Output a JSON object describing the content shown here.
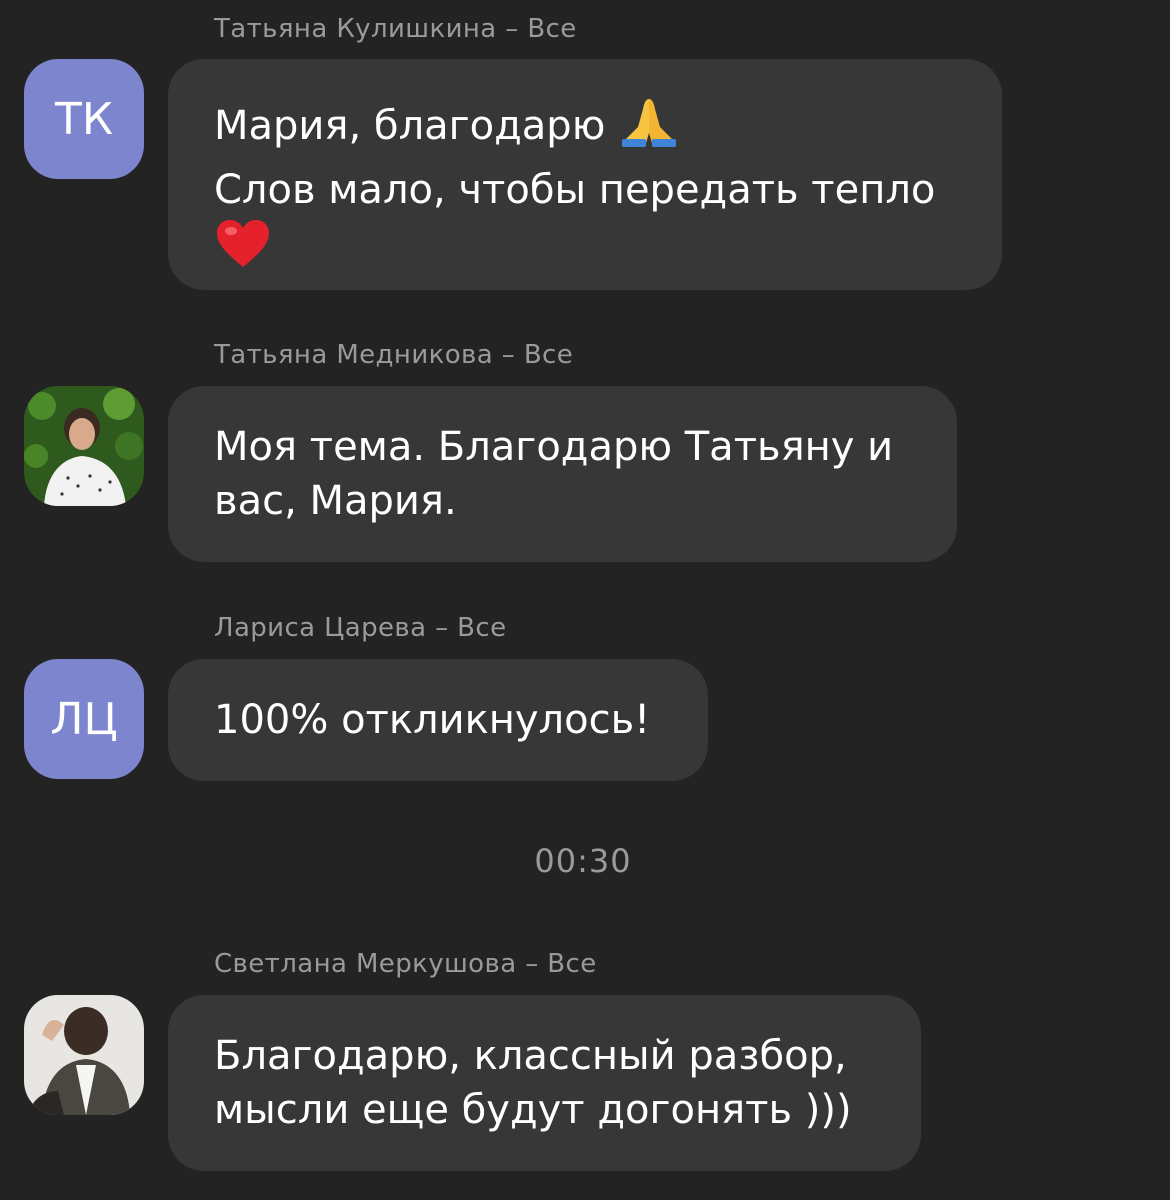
{
  "messages": [
    {
      "sender": "Татьяна Кулишкина – Все",
      "avatar": {
        "type": "initials",
        "text": "ТК",
        "color": "#7d85cf"
      },
      "lines": [
        "Мария, благодарю",
        "Слов мало, чтобы передать тепло"
      ],
      "emojis": [
        "folded-hands-icon",
        "red-heart-icon"
      ]
    },
    {
      "sender": "Татьяна Медникова – Все",
      "avatar": {
        "type": "photo",
        "icon": "user-photo-avatar"
      },
      "lines": [
        "Моя тема. Благодарю Татьяну и",
        "вас, Мария."
      ]
    },
    {
      "sender": "Лариса Царева – Все",
      "avatar": {
        "type": "initials",
        "text": "ЛЦ",
        "color": "#7d85cf"
      },
      "lines": [
        "100% откликнулось!"
      ]
    },
    {
      "sender": "Светлана Меркушова – Все",
      "avatar": {
        "type": "photo",
        "icon": "user-photo-avatar"
      },
      "lines": [
        "Благодарю, классный разбор,",
        "мысли еще будут догонять )))"
      ]
    }
  ],
  "timestamp": "00:30",
  "colors": {
    "background": "#232323",
    "bubble": "#373737",
    "avatar_initials_bg": "#7d85cf",
    "meta_text": "#9a9a9a"
  }
}
